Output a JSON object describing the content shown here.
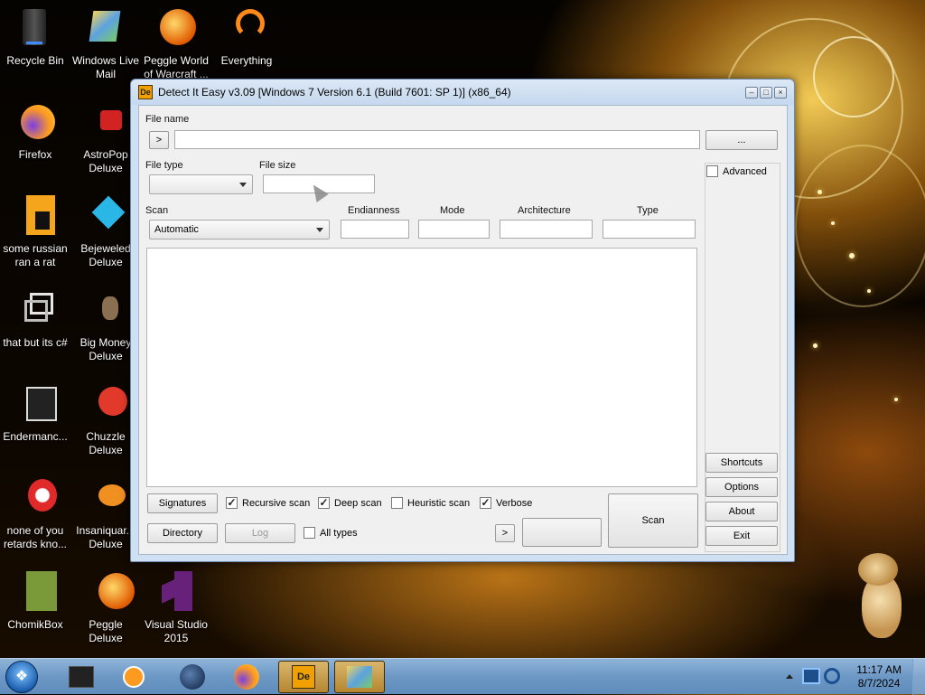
{
  "desktop": {
    "icons": [
      {
        "label": "Recycle Bin",
        "icon": "recycle-bin-icon"
      },
      {
        "label": "Windows Live Mail",
        "icon": "mail-icon"
      },
      {
        "label": "Peggle World of Warcraft ...",
        "icon": "peggle-icon"
      },
      {
        "label": "Everything",
        "icon": "search-app-icon"
      },
      {
        "label": "Firefox",
        "icon": "firefox-icon"
      },
      {
        "label": "AstroPop Deluxe",
        "icon": "game-icon"
      },
      {
        "label": "some russian ran a rat",
        "icon": "app-icon"
      },
      {
        "label": "Bejeweled Deluxe",
        "icon": "game-icon"
      },
      {
        "label": "that but its c#",
        "icon": "shortcut-icon"
      },
      {
        "label": "Big Money Deluxe",
        "icon": "game-icon"
      },
      {
        "label": "Endermanc...",
        "icon": "app-icon"
      },
      {
        "label": "Chuzzle Deluxe",
        "icon": "game-icon"
      },
      {
        "label": "none of you retards kno...",
        "icon": "app-icon"
      },
      {
        "label": "Insaniquar... Deluxe",
        "icon": "game-icon"
      },
      {
        "label": "ChomikBox",
        "icon": "chomikbox-icon"
      },
      {
        "label": "Peggle Deluxe",
        "icon": "peggle-icon"
      },
      {
        "label": "Visual Studio 2015",
        "icon": "visual-studio-icon"
      }
    ]
  },
  "window": {
    "app_icon_text": "De",
    "title": "Detect It Easy v3.09 [Windows 7 Version 6.1 (Build 7601: SP 1)] (x86_64)",
    "file_name_label": "File name",
    "file_name_value": "",
    "go_button": ">",
    "browse_button": "...",
    "file_type_label": "File type",
    "file_type_value": "",
    "file_size_label": "File size",
    "file_size_value": "",
    "advanced_label": "Advanced",
    "scan_label": "Scan",
    "scan_mode_value": "Automatic",
    "endianness_label": "Endianness",
    "mode_label": "Mode",
    "architecture_label": "Architecture",
    "type_label": "Type",
    "shortcuts_button": "Shortcuts",
    "options_button": "Options",
    "about_button": "About",
    "exit_button": "Exit",
    "signatures_button": "Signatures",
    "directory_button": "Directory",
    "log_button": "Log",
    "recursive_scan_label": "Recursive scan",
    "recursive_scan_checked": true,
    "deep_scan_label": "Deep scan",
    "deep_scan_checked": true,
    "heuristic_scan_label": "Heuristic scan",
    "heuristic_scan_checked": false,
    "verbose_label": "Verbose",
    "verbose_checked": true,
    "all_types_label": "All types",
    "all_types_checked": false,
    "next_button": ">",
    "scan_button": "Scan"
  },
  "taskbar": {
    "items": [
      "terminal-icon",
      "media-player-icon",
      "globe-icon",
      "firefox-icon",
      "detect-it-easy-icon",
      "folder-app-icon"
    ],
    "clock_time": "11:17 AM",
    "clock_date": "8/7/2024"
  }
}
